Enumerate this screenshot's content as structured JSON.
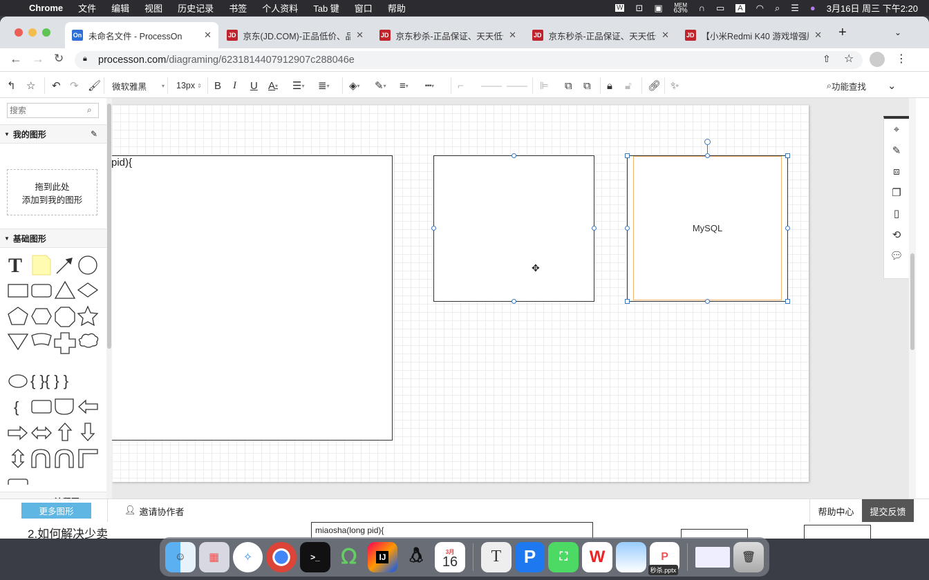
{
  "menubar": {
    "apple": "",
    "app": "Chrome",
    "items": [
      "文件",
      "编辑",
      "视图",
      "历史记录",
      "书签",
      "个人资料",
      "Tab 键",
      "窗口",
      "帮助"
    ],
    "mem_label": "MEM",
    "mem": "63%",
    "input": "A",
    "datetime": "3月16日 周三 下午2:20"
  },
  "tabs": [
    {
      "icon": "On",
      "title": "未命名文件 - ProcessOn",
      "color": "#2d6fd6"
    },
    {
      "icon": "JD",
      "title": "京东(JD.COM)-正品低价、品",
      "color": "#c0232c"
    },
    {
      "icon": "JD",
      "title": "京东秒杀-正品保证、天天低价",
      "color": "#c0232c"
    },
    {
      "icon": "JD",
      "title": "京东秒杀-正品保证、天天低价",
      "color": "#c0232c"
    },
    {
      "icon": "JD",
      "title": "【小米Redmi K40 游戏增强版",
      "color": "#c0232c"
    }
  ],
  "address": {
    "url_host": "processon.com",
    "url_path": "/diagraming/6231814407912907c288046e"
  },
  "toolbar": {
    "font": "微软雅黑",
    "size": "13px",
    "search": "功能查找"
  },
  "sidebar": {
    "search_placeholder": "搜索",
    "my_shapes": "我的图形",
    "drop_line1": "拖到此处",
    "drop_line2": "添加到我的图形",
    "basic": "基础图形",
    "flowchart": "Flowchart 流程图",
    "more": "更多图形"
  },
  "canvas": {
    "shape1_text": "pid){",
    "shape3_text": "MySQL",
    "accent": "#3a78c2",
    "selected_inner": "#f0b56a"
  },
  "bottom": {
    "invite": "邀请协作者",
    "help": "帮助中心",
    "feedback": "提交反馈"
  },
  "behind": {
    "heading": "2.如何解决少卖",
    "code": "miaosha(long pid){"
  },
  "dock": {
    "calendar_month": "3月",
    "calendar_day": "16",
    "tooltip": "秒杀.pptx"
  }
}
